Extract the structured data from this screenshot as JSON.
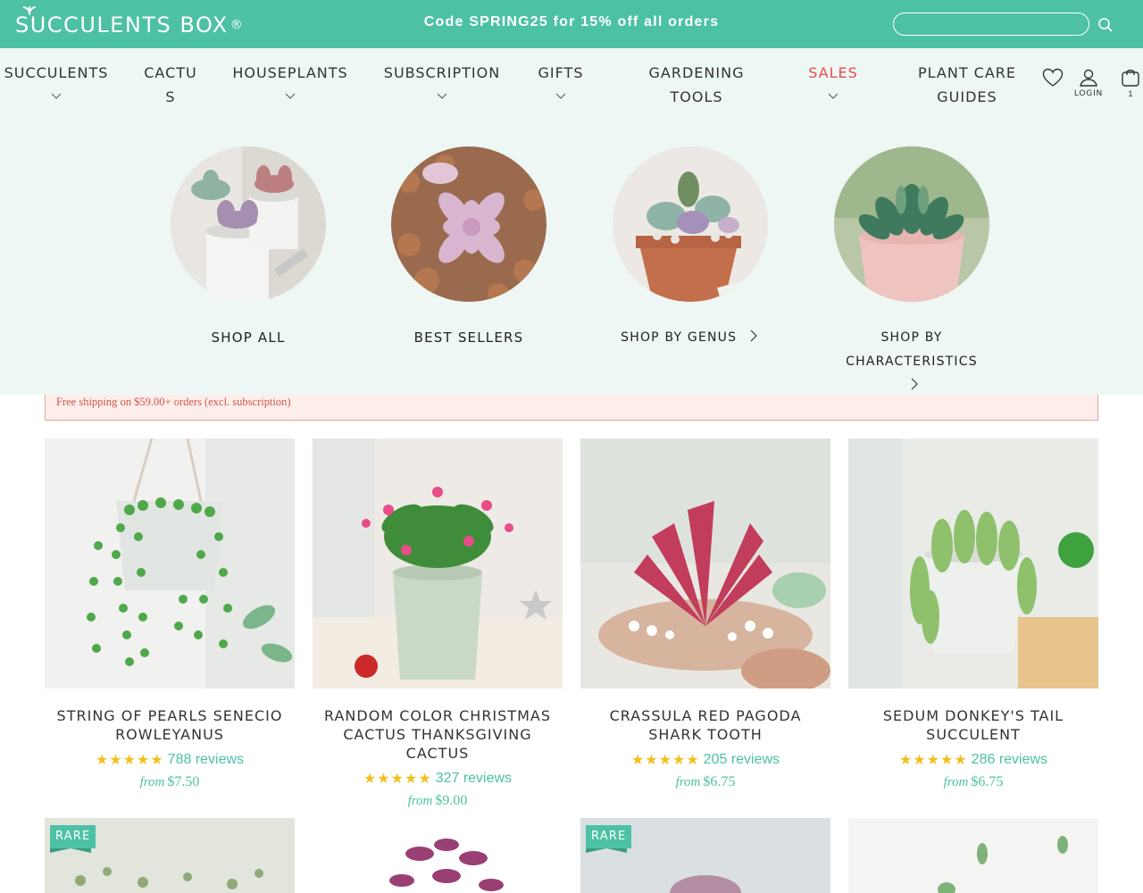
{
  "header": {
    "logo_text": "SUCCULENTS BOX",
    "logo_reg": "®",
    "promo": "Code SPRING25 for 15% off all orders",
    "search_placeholder": ""
  },
  "nav": {
    "items": [
      {
        "label": "SUCCULENTS",
        "has_dropdown": true
      },
      {
        "label": "CACTUS",
        "has_dropdown": false
      },
      {
        "label": "HOUSEPLANTS",
        "has_dropdown": true
      },
      {
        "label": "SUBSCRIPTION",
        "has_dropdown": true
      },
      {
        "label": "GIFTS",
        "has_dropdown": true
      },
      {
        "label": "GARDENING TOOLS",
        "has_dropdown": true
      },
      {
        "label": "SALES",
        "has_dropdown": true
      },
      {
        "label": "PLANT CARE GUIDES",
        "has_dropdown": false
      }
    ],
    "login_label": "LOGIN",
    "cart_count": "1"
  },
  "mega_menu": {
    "categories": [
      {
        "label": "SHOP ALL"
      },
      {
        "label": "BEST SELLERS"
      },
      {
        "label": "SHOP BY GENUS"
      },
      {
        "label": "SHOP BY CHARACTERISTICS"
      }
    ]
  },
  "shipping_banner": "Free shipping on $59.00+ orders (excl. subscription)",
  "products": [
    {
      "name": "STRING OF PEARLS SENECIO ROWLEYANUS",
      "stars": "★★★★★",
      "reviews": "788 reviews",
      "price_prefix": "from",
      "price": "$7.50"
    },
    {
      "name": "RANDOM COLOR CHRISTMAS CACTUS THANKSGIVING CACTUS",
      "stars": "★★★★★",
      "reviews": "327 reviews",
      "price_prefix": "from",
      "price": "$9.00"
    },
    {
      "name": "CRASSULA RED PAGODA SHARK TOOTH",
      "stars": "★★★★★",
      "reviews": "205 reviews",
      "price_prefix": "from",
      "price": "$6.75"
    },
    {
      "name": "SEDUM DONKEY'S TAIL SUCCULENT",
      "stars": "★★★★★",
      "reviews": "286 reviews",
      "price_prefix": "from",
      "price": "$6.75"
    }
  ],
  "next_row_badges": [
    "RARE",
    "",
    "RARE",
    ""
  ],
  "colors": {
    "brand": "#4dc1a3",
    "sale": "#e84b4b",
    "star": "#f2c01d"
  }
}
